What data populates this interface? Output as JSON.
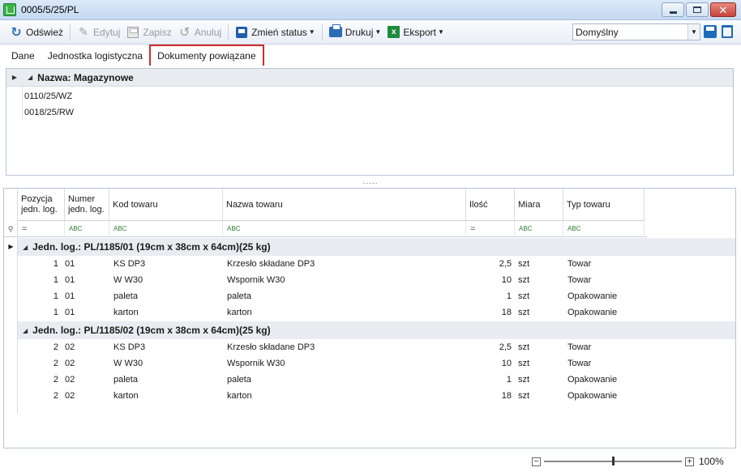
{
  "window": {
    "title": "0005/5/25/PL"
  },
  "toolbar": {
    "refresh_label": "Odśwież",
    "edit_label": "Edytuj",
    "save_label": "Zapisz",
    "cancel_label": "Anuluj",
    "status_label": "Zmień status",
    "print_label": "Drukuj",
    "export_label": "Eksport",
    "layout_combo_value": "Domyślny"
  },
  "tabs": [
    {
      "label": "Dane"
    },
    {
      "label": "Jednostka logistyczna"
    },
    {
      "label": "Dokumenty powiązane"
    }
  ],
  "related_docs": {
    "group_label": "Nazwa: Magazynowe",
    "items": [
      "0110/25/WZ",
      "0018/25/RW"
    ]
  },
  "grid": {
    "columns": [
      {
        "label": "Pozycja jedn. log."
      },
      {
        "label": "Numer jedn. log."
      },
      {
        "label": "Kod towaru"
      },
      {
        "label": "Nazwa towaru"
      },
      {
        "label": "Ilość"
      },
      {
        "label": "Miara"
      },
      {
        "label": "Typ towaru"
      }
    ],
    "filter_symbols": [
      "=",
      "ABC",
      "ABC",
      "ABC",
      "=",
      "ABC",
      "ABC"
    ],
    "groups": [
      {
        "label": "Jedn. log.: PL/1185/01 (19cm x 38cm x 64cm)(25 kg)",
        "rows": [
          {
            "poz": "1",
            "num": "01",
            "kod": "KS DP3",
            "nazwa": "Krzesło składane DP3",
            "ilosc": "2,5",
            "miara": "szt",
            "typ": "Towar"
          },
          {
            "poz": "1",
            "num": "01",
            "kod": "W W30",
            "nazwa": "Wspornik W30",
            "ilosc": "10",
            "miara": "szt",
            "typ": "Towar"
          },
          {
            "poz": "1",
            "num": "01",
            "kod": "paleta",
            "nazwa": "paleta",
            "ilosc": "1",
            "miara": "szt",
            "typ": "Opakowanie"
          },
          {
            "poz": "1",
            "num": "01",
            "kod": "karton",
            "nazwa": "karton",
            "ilosc": "18",
            "miara": "szt",
            "typ": "Opakowanie"
          }
        ]
      },
      {
        "label": "Jedn. log.: PL/1185/02 (19cm x 38cm x 64cm)(25 kg)",
        "rows": [
          {
            "poz": "2",
            "num": "02",
            "kod": "KS DP3",
            "nazwa": "Krzesło składane DP3",
            "ilosc": "2,5",
            "miara": "szt",
            "typ": "Towar"
          },
          {
            "poz": "2",
            "num": "02",
            "kod": "W W30",
            "nazwa": "Wspornik W30",
            "ilosc": "10",
            "miara": "szt",
            "typ": "Towar"
          },
          {
            "poz": "2",
            "num": "02",
            "kod": "paleta",
            "nazwa": "paleta",
            "ilosc": "1",
            "miara": "szt",
            "typ": "Opakowanie"
          },
          {
            "poz": "2",
            "num": "02",
            "kod": "karton",
            "nazwa": "karton",
            "ilosc": "18",
            "miara": "szt",
            "typ": "Opakowanie"
          }
        ]
      }
    ]
  },
  "zoom": {
    "percent_label": "100%",
    "value": 100
  },
  "splitter_glyph": "....."
}
